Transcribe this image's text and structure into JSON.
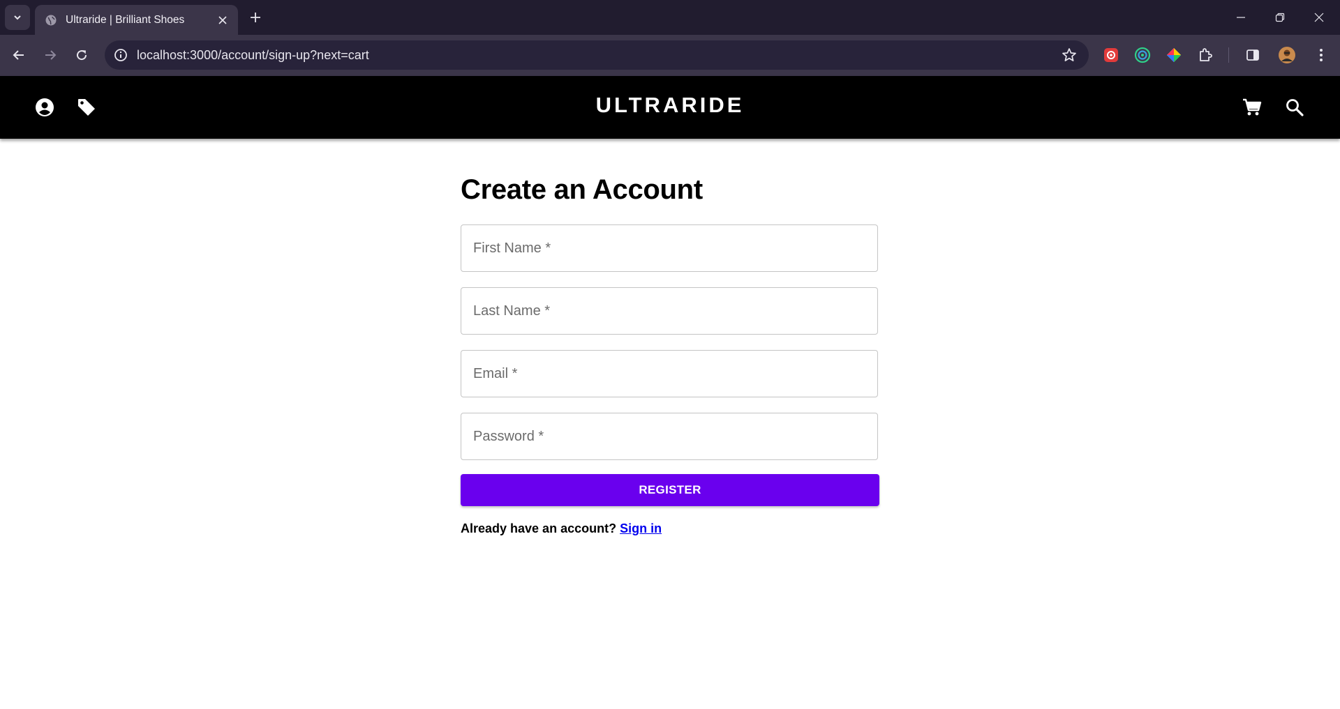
{
  "browser": {
    "tab_title": "Ultraride | Brilliant Shoes",
    "url": "localhost:3000/account/sign-up?next=cart"
  },
  "header": {
    "brand": "ULTRARIDE"
  },
  "form": {
    "title": "Create an Account",
    "first_name_placeholder": "First Name *",
    "last_name_placeholder": "Last Name *",
    "email_placeholder": "Email *",
    "password_placeholder": "Password *",
    "register_label": "REGISTER",
    "signin_prompt": "Already have an account?",
    "signin_link": "Sign in"
  },
  "colors": {
    "accent": "#6a00ee",
    "header_bg": "#000000",
    "chrome_bg": "#211c2f",
    "link": "#0000ee"
  }
}
